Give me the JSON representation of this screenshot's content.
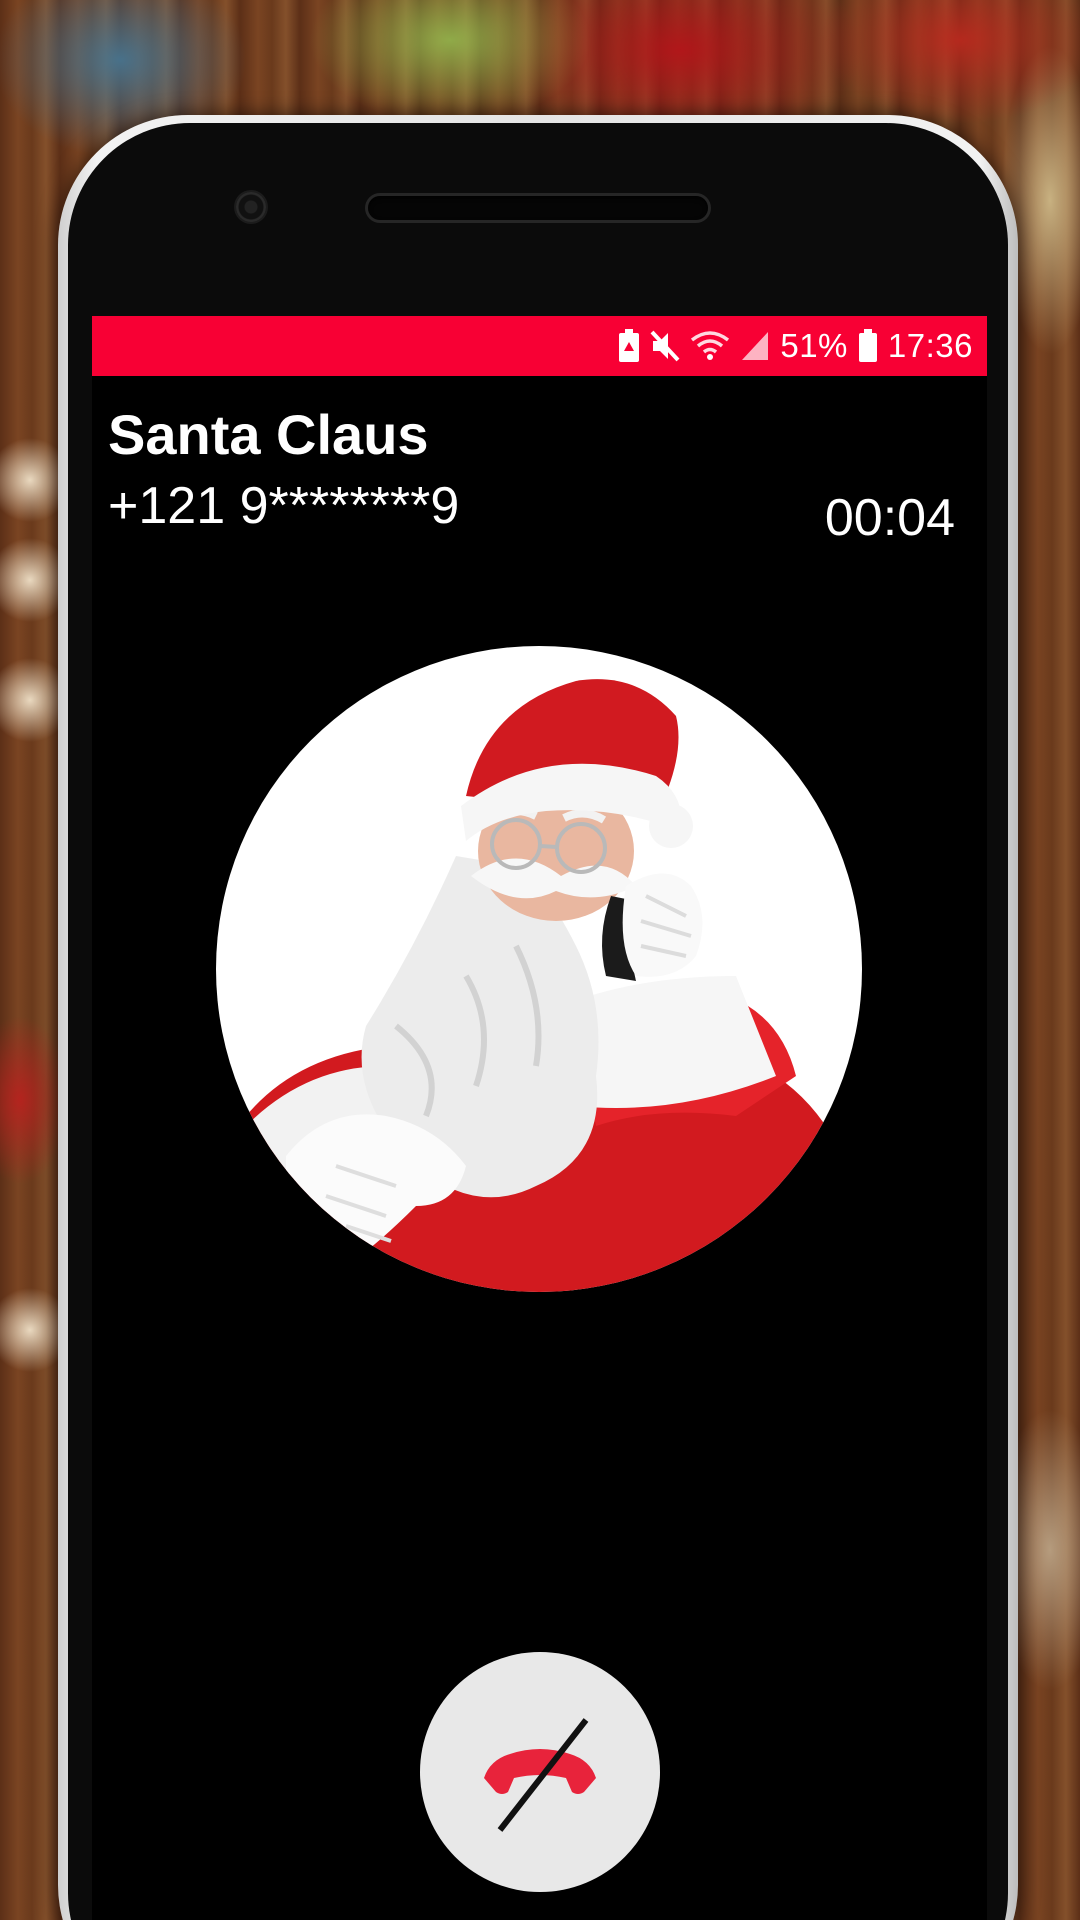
{
  "status_bar": {
    "battery_percent": "51%",
    "time": "17:36",
    "icons": [
      "battery-saver-icon",
      "mute-icon",
      "wifi-icon",
      "signal-icon",
      "battery-icon"
    ],
    "color": "#f80034"
  },
  "call": {
    "contact_name": "Santa Claus",
    "phone_number": "+121 9********9",
    "duration": "00:04"
  },
  "actions": {
    "end_call_icon": "end-call-icon",
    "end_call_color": "#e8233b"
  }
}
